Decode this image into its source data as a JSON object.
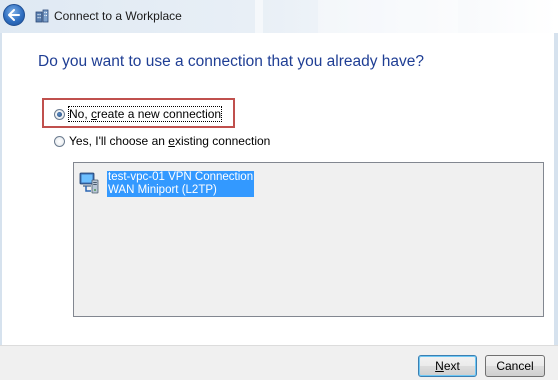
{
  "window": {
    "title": "Connect to a Workplace",
    "back_icon": "back-arrow-icon",
    "app_icon": "workplace-icon"
  },
  "heading": "Do you want to use a connection that you already have?",
  "options": {
    "new_connection": {
      "prefix": "No, ",
      "access_key": "c",
      "suffix": "reate a new connection",
      "selected": true
    },
    "existing_connection": {
      "prefix": "Yes, I'll choose an ",
      "access_key": "e",
      "suffix": "xisting connection",
      "selected": false
    }
  },
  "connections": [
    {
      "name": "test-vpc-01 VPN Connection",
      "device": "WAN Miniport (L2TP)",
      "icon": "network-connection-icon",
      "selected": true
    }
  ],
  "buttons": {
    "next": {
      "access_key": "N",
      "rest": "ext"
    },
    "cancel": "Cancel"
  },
  "colors": {
    "heading": "#1f3e94",
    "selection": "#3399ff",
    "highlight_box": "#c0504d"
  }
}
